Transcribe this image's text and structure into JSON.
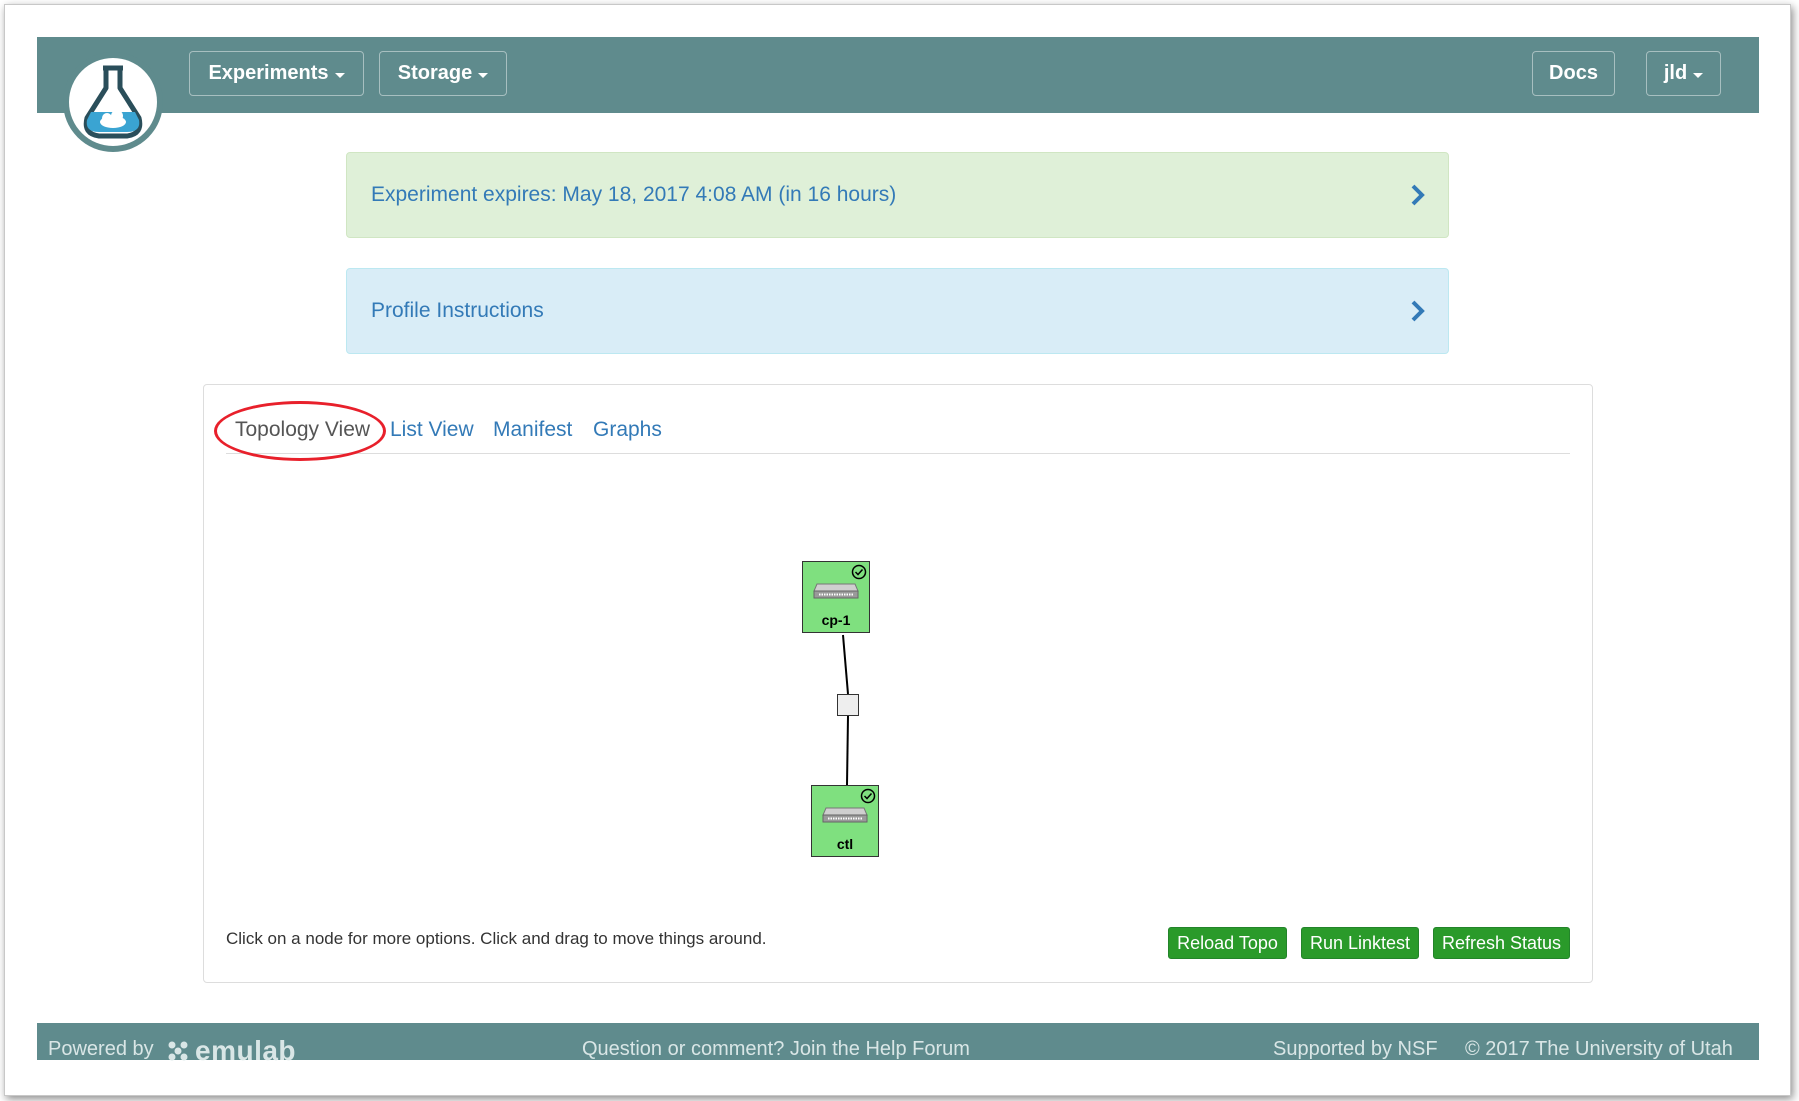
{
  "navbar": {
    "experiments_label": "Experiments",
    "storage_label": "Storage",
    "docs_label": "Docs",
    "user_label": "jld"
  },
  "alerts": {
    "expires": "Experiment expires: May 18, 2017 4:08 AM (in 16 hours)",
    "instructions": "Profile Instructions"
  },
  "tabs": {
    "topology": "Topology View",
    "list": "List View",
    "manifest": "Manifest",
    "graphs": "Graphs"
  },
  "topology": {
    "nodes": [
      {
        "name": "cp-1",
        "status": "ready"
      },
      {
        "name": "ctl",
        "status": "ready"
      }
    ]
  },
  "hint": "Click on a node for more options. Click and drag to move things around.",
  "actions": {
    "reload": "Reload Topo",
    "linktest": "Run Linktest",
    "refresh": "Refresh Status"
  },
  "footer": {
    "powered_by": "Powered by",
    "brand": "emulab",
    "help": "Question or comment? Join the Help Forum",
    "nsf": "Supported by NSF",
    "copyright": "© 2017 The University of Utah"
  },
  "colors": {
    "navbar": "#5f8b8d",
    "link": "#337ab7",
    "node": "#7fe07f",
    "button": "#2a9a2a",
    "annotation": "#e8202b"
  }
}
